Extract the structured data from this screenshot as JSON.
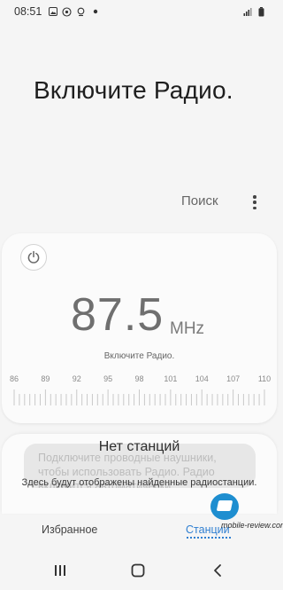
{
  "status_bar": {
    "time": "08:51",
    "left_icons": [
      "gallery-icon",
      "app-icon",
      "location-icon",
      "dot-icon"
    ],
    "right_icons": [
      "signal-icon",
      "battery-icon"
    ]
  },
  "headline": "Включите Радио.",
  "toolbar": {
    "search_label": "Поиск",
    "more_icon": "more-vertical-icon"
  },
  "tuner": {
    "power_icon": "power-icon",
    "frequency": "87.5",
    "unit": "MHz",
    "status": "Включите Радио.",
    "scale_labels": [
      "86",
      "89",
      "92",
      "95",
      "98",
      "101",
      "104",
      "107",
      "110"
    ]
  },
  "stations": {
    "title": "Нет станций",
    "toast_text": "Подключите проводные наушники, чтобы использовать Радио. Радио включится автоматически.",
    "hint": "Здесь будут отображены найденные радиостанции."
  },
  "tabs": {
    "favorites": "Избранное",
    "stations": "Станции"
  },
  "watermark": "mobile-review.com",
  "navbar": {
    "recents_icon": "recents-icon",
    "home_icon": "home-icon",
    "back_icon": "back-icon"
  },
  "colors": {
    "accent": "#2f7fd1",
    "background": "#f5f5f5",
    "card": "#fbfbfb"
  }
}
